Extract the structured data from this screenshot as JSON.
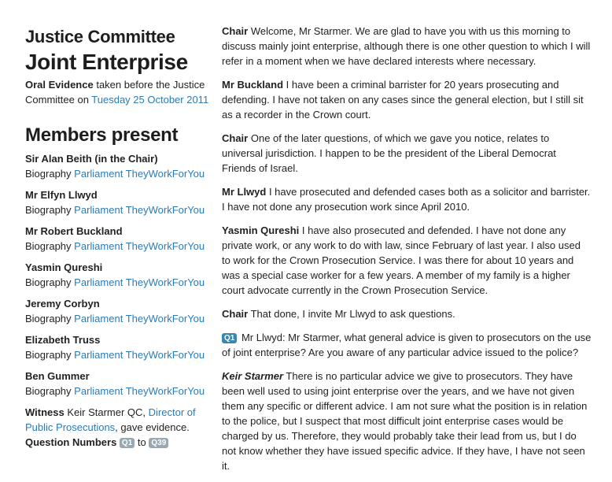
{
  "sidebar": {
    "committee_title": "Justice Committee",
    "inquiry_title": "Joint Enterprise",
    "evidence": {
      "prefix_bold": "Oral Evidence",
      "middle": " taken before the Justice Committee on ",
      "date_link": "Tuesday 25 October 2011"
    },
    "members_heading": "Members present",
    "biography_label": "Biography",
    "link_parliament": "Parliament",
    "link_twfy": "TheyWorkForYou",
    "members": [
      {
        "name": "Sir Alan Beith (in the Chair)"
      },
      {
        "name": "Mr Elfyn Llwyd"
      },
      {
        "name": "Mr Robert Buckland"
      },
      {
        "name": "Yasmin Qureshi"
      },
      {
        "name": "Jeremy Corbyn"
      },
      {
        "name": "Elizabeth Truss"
      },
      {
        "name": "Ben Gummer"
      }
    ],
    "witness": {
      "label": "Witness",
      "text": " Keir Starmer QC, ",
      "link": "Director of Public Prosecutions",
      "suffix": ", gave evidence."
    },
    "question_numbers": {
      "label": "Question Numbers",
      "from": "Q1",
      "to_word": "to",
      "to": "Q39"
    }
  },
  "transcript": [
    {
      "speaker": "Chair",
      "text": " Welcome, Mr Starmer. We are glad to have you with us this morning to discuss mainly joint enterprise, although there is one other question to which I will refer in a moment when we have declared interests where necessary."
    },
    {
      "speaker": "Mr Buckland",
      "text": " I have been a criminal barrister for 20 years prosecuting and defending. I have not taken on any cases since the general election, but I still sit as a recorder in the Crown court."
    },
    {
      "speaker": "Chair",
      "text": " One of the later questions, of which we gave you notice, relates to universal jurisdiction. I happen to be the president of the Liberal Democrat Friends of Israel."
    },
    {
      "speaker": "Mr Llwyd",
      "text": " I have prosecuted and defended cases both as a solicitor and barrister. I have not done any prosecution work since April 2010."
    },
    {
      "speaker": "Yasmin Qureshi",
      "text": " I have also prosecuted and defended. I have not done any private work, or any work to do with law, since February of last year. I also used to work for the Crown Prosecution Service. I was there for about 10 years and was a special case worker for a few years. A member of my family is a higher court advocate currently in the Crown Prosecution Service."
    },
    {
      "speaker": "Chair",
      "text": " That done, I invite Mr Llwyd to ask questions."
    },
    {
      "question": "Q1",
      "text": " Mr Llwyd: Mr Starmer, what general advice is given to prosecutors on the use of joint enterprise? Are you aware of any particular advice issued to the police?"
    },
    {
      "speaker": "Keir Starmer",
      "italic": true,
      "text": " There is no particular advice we give to prosecutors. They have been well used to using joint enterprise over the years, and we have not given them any specific or different advice. I am not sure what the position is in relation to the police, but I suspect that most difficult joint enterprise cases would be charged by us. Therefore, they would probably take their lead from us, but I do not know whether they have issued specific advice. If they have, I have not seen it."
    }
  ]
}
